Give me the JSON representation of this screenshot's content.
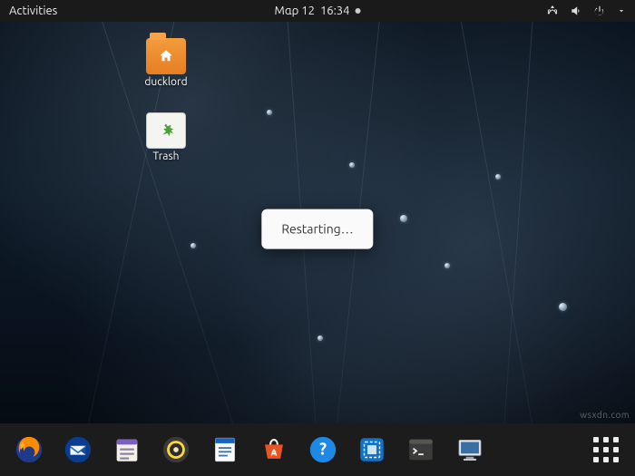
{
  "topbar": {
    "activities": "Activities",
    "date": "Μαρ 12",
    "time": "16:34"
  },
  "desktop_icons": {
    "home": {
      "label": "ducklord"
    },
    "trash": {
      "label": "Trash"
    }
  },
  "dialog": {
    "message": "Restarting…"
  },
  "dock": {
    "firefox": "Firefox",
    "thunderbird": "Thunderbird",
    "files": "Files",
    "rhythmbox": "Rhythmbox",
    "writer": "LibreOffice Writer",
    "software": "Ubuntu Software",
    "help": "Help",
    "screenshot": "Screenshot",
    "terminal": "Terminal",
    "remote": "Remote Desktop",
    "apps": "Show Applications"
  },
  "watermark": "wsxdn.com"
}
